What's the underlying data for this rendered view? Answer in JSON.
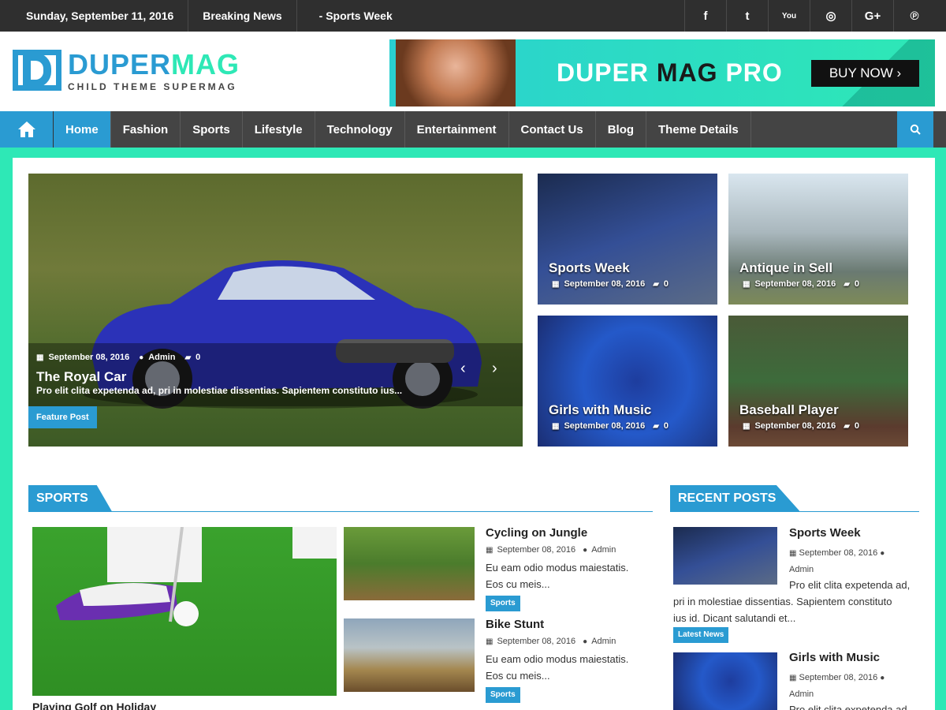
{
  "topbar": {
    "date": "Sunday, September 11, 2016",
    "breaking_label": "Breaking News",
    "breaking_item": "- Sports Week",
    "social": [
      "f",
      "t",
      "You",
      "◎",
      "G+",
      "℗"
    ]
  },
  "header": {
    "logo_letter": "D",
    "logo_title_1": "DUPER",
    "logo_title_2": "MAG",
    "logo_sub": "CHILD THEME SUPERMAG",
    "banner_text_1": "DUPER ",
    "banner_text_2": "MAG",
    "banner_text_3": " PRO",
    "banner_button": "BUY NOW  ›"
  },
  "nav": {
    "items": [
      "Home",
      "Fashion",
      "Sports",
      "Lifestyle",
      "Technology",
      "Entertainment",
      "Contact Us",
      "Blog",
      "Theme Details"
    ]
  },
  "feature": {
    "date": "September 08, 2016",
    "author": "Admin",
    "comments": "0",
    "title": "The Royal Car",
    "excerpt": "Pro elit clita expetenda ad, pri in molestiae dissentias. Sapientem constituto ius...",
    "badge": "Feature Post",
    "prev": "‹",
    "next": "›"
  },
  "tiles": [
    {
      "title": "Sports Week",
      "date": "September 08, 2016",
      "comments": "0"
    },
    {
      "title": "Antique in Sell",
      "date": "September 08, 2016",
      "comments": "0"
    },
    {
      "title": "Girls with Music",
      "date": "September 08, 2016",
      "comments": "0"
    },
    {
      "title": "Baseball Player",
      "date": "September 08, 2016",
      "comments": "0"
    }
  ],
  "sports": {
    "heading": "SPORTS",
    "main_caption": "Playing Golf on Holiday",
    "posts": [
      {
        "title": "Cycling on Jungle",
        "date": "September 08, 2016",
        "author": "Admin",
        "excerpt_1": "Eu eam odio modus maiestatis.",
        "excerpt_2": "Eos cu meis...",
        "category": "Sports"
      },
      {
        "title": "Bike Stunt",
        "date": "September 08, 2016",
        "author": "Admin",
        "excerpt_1": "Eu eam odio modus maiestatis.",
        "excerpt_2": "Eos cu meis...",
        "category": "Sports"
      }
    ]
  },
  "recent": {
    "heading": "RECENT POSTS",
    "posts": [
      {
        "title": "Sports Week",
        "date": "September 08, 2016",
        "author": "Admin",
        "excerpt_1": "Pro elit clita expetenda ad,",
        "excerpt_2": "pri in molestiae dissentias. Sapientem constituto",
        "excerpt_3": "ius id. Dicant salutandi et...",
        "badge": "Latest News"
      },
      {
        "title": "Girls with Music",
        "date": "September 08, 2016",
        "author": "Admin",
        "excerpt_1": "Pro elit clita expetenda ad",
        "badge": ""
      }
    ]
  },
  "colors": {
    "accent": "#2a9bd2",
    "secondary": "#2ee8b6",
    "topbar": "#2f2f2f",
    "nav": "#444444"
  }
}
